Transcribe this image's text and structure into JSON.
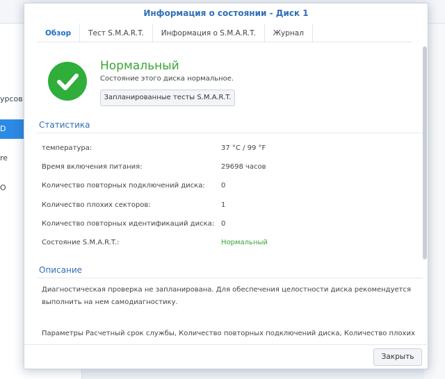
{
  "background": {
    "sidebar_items": [
      {
        "label": "урсов",
        "active": false
      },
      {
        "label": "D",
        "active": true
      },
      {
        "label": "re",
        "active": false
      },
      {
        "label": "O",
        "active": false
      }
    ]
  },
  "dialog": {
    "title": "Информация о состоянии - Диск 1",
    "tabs": [
      {
        "label": "Обзор",
        "active": true
      },
      {
        "label": "Тест S.M.A.R.T.",
        "active": false
      },
      {
        "label": "Информация о S.M.A.R.T.",
        "active": false
      },
      {
        "label": "Журнал",
        "active": false
      }
    ]
  },
  "overview": {
    "status_icon": "check-circle-icon",
    "status_title": "Нормальный",
    "status_description": "Состояние этого диска нормальное.",
    "scheduled_tests_button": "Запланированные тесты S.M.A.R.T."
  },
  "statistics": {
    "title": "Статистика",
    "rows": [
      {
        "label": "температура:",
        "value": "37 °C / 99 °F",
        "ok": false
      },
      {
        "label": "Время включения питания:",
        "value": "29698 часов",
        "ok": false
      },
      {
        "label": "Количество повторных подключений диска:",
        "value": "0",
        "ok": false
      },
      {
        "label": "Количество плохих секторов:",
        "value": "1",
        "ok": false
      },
      {
        "label": "Количество повторных идентификаций диска:",
        "value": "0",
        "ok": false
      },
      {
        "label": "Состояние S.M.A.R.T.:",
        "value": "Нормальный",
        "ok": true
      }
    ]
  },
  "description": {
    "title": "Описание",
    "paragraph1": "Диагностическая проверка не запланирована. Для обеспечения целостности диска рекомендуется выполнить на нем самодиагностику.",
    "paragraph2": "Параметры Расчетный срок службы, Количество повторных подключений диска, Количество плохих секторов и"
  },
  "footer": {
    "close_button": "Закрыть"
  },
  "colors": {
    "accent": "#2f6fb5",
    "ok_green": "#3aa535",
    "icon_green": "#2fae3a",
    "sidebar_active": "#2b8ae3"
  }
}
